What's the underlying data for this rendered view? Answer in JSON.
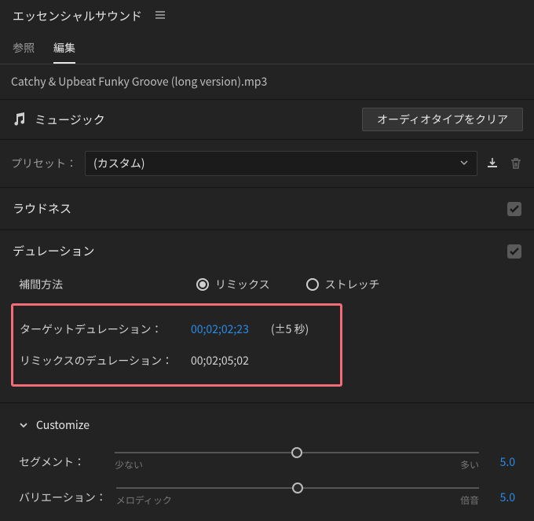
{
  "panel": {
    "title": "エッセンシャルサウンド"
  },
  "tabs": {
    "browse": "参照",
    "edit": "編集"
  },
  "clip": {
    "name": "Catchy & Upbeat Funky Groove (long version).mp3"
  },
  "typeRow": {
    "label": "ミュージック",
    "clear": "オーディオタイプをクリア"
  },
  "preset": {
    "label": "プリセット：",
    "value": "(カスタム)"
  },
  "sections": {
    "loudness": {
      "title": "ラウドネス"
    },
    "duration": {
      "title": "デュレーション",
      "interp_label": "補間方法",
      "opt_remix": "リミックス",
      "opt_stretch": "ストレッチ",
      "target_label": "ターゲットデュレーション：",
      "target_value": "00;02;02;23",
      "target_suffix": "(±5 秒)",
      "remix_label": "リミックスのデュレーション：",
      "remix_value": "00;02;05;02"
    }
  },
  "customize": {
    "title": "Customize",
    "segments": {
      "label": "セグメント：",
      "left": "少ない",
      "right": "多い",
      "value": "5.0",
      "pos": 50
    },
    "variation": {
      "label": "バリエーション：",
      "left": "メロディック",
      "right": "倍音",
      "value": "5.0",
      "pos": 50
    }
  }
}
